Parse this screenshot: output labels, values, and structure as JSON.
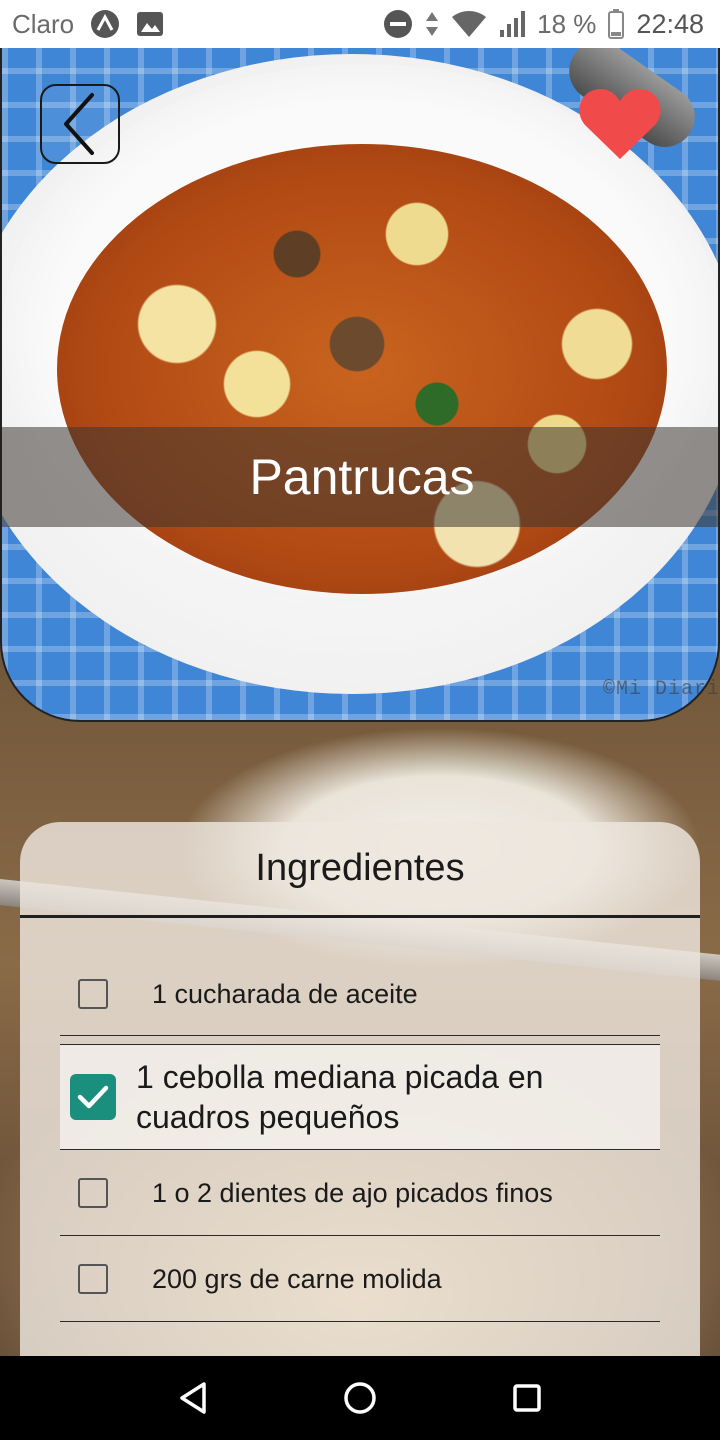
{
  "status_bar": {
    "carrier": "Claro",
    "battery": "18 %",
    "time": "22:48"
  },
  "recipe": {
    "title": "Pantrucas",
    "watermark": "©Mi Diari",
    "favorite": true
  },
  "ingredients": {
    "header": "Ingredientes",
    "items": [
      {
        "text": "1 cucharada de aceite",
        "checked": false
      },
      {
        "text": "1 cebolla mediana picada en cuadros pequeños",
        "checked": true
      },
      {
        "text": "1 o 2 dientes de ajo picados finos",
        "checked": false
      },
      {
        "text": "200 grs de carne molida",
        "checked": false
      }
    ]
  },
  "icons": {
    "back": "chevron-left-icon",
    "favorite": "heart-icon",
    "nav_back": "triangle-back-icon",
    "nav_home": "circle-home-icon",
    "nav_recents": "square-recents-icon"
  },
  "colors": {
    "heart": "#f04a4a",
    "checkbox_checked": "#1a8f7e"
  }
}
